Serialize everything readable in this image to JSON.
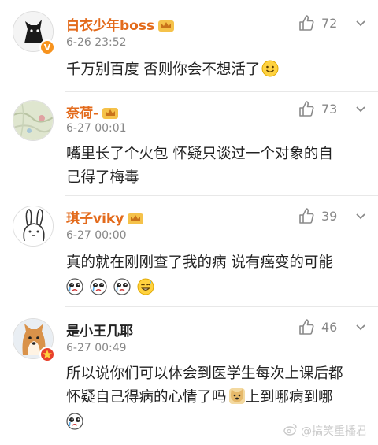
{
  "comments": [
    {
      "username": "白衣少年boss",
      "time": "6-26 23:52",
      "likes": "72",
      "text_lines": [
        "千万别百度  否则你会不想活了"
      ],
      "emoji": [
        "smile-emoji"
      ],
      "avatar": "black-cat-silhouette",
      "verified": true,
      "crown": true
    },
    {
      "username": "奈荷-",
      "time": "6-27 00:01",
      "likes": "73",
      "text_lines": [
        "嘴里长了个火包  怀疑只谈过一个对象的自",
        "己得了梅毒"
      ],
      "emoji": [],
      "avatar": "map-pattern",
      "verified": false,
      "crown": true
    },
    {
      "username": "琪子viky",
      "time": "6-27 00:00",
      "likes": "39",
      "text_lines": [
        "真的就在刚刚查了我的病 说有癌变的可能"
      ],
      "emoji": [
        "crying-emoji",
        "crying-emoji",
        "crying-emoji",
        "sweat-smile-emoji"
      ],
      "avatar": "bunny-doodle",
      "verified": false,
      "crown": true
    },
    {
      "username": "是小王几耶",
      "time": "6-27 00:49",
      "likes": "46",
      "text_lines": [
        "所以说你们可以体会到医学生每次上课后都",
        "怀疑自己得病的心情了吗",
        "上到哪病到哪"
      ],
      "emoji": [
        "doge-emoji",
        "crying-emoji"
      ],
      "avatar": "shiba-dog",
      "verified": true,
      "crown": false
    }
  ],
  "watermark": "@搞笑重播君",
  "colors": {
    "username": "#e36b1c",
    "meta": "#888888",
    "badge": "#f7931e"
  }
}
